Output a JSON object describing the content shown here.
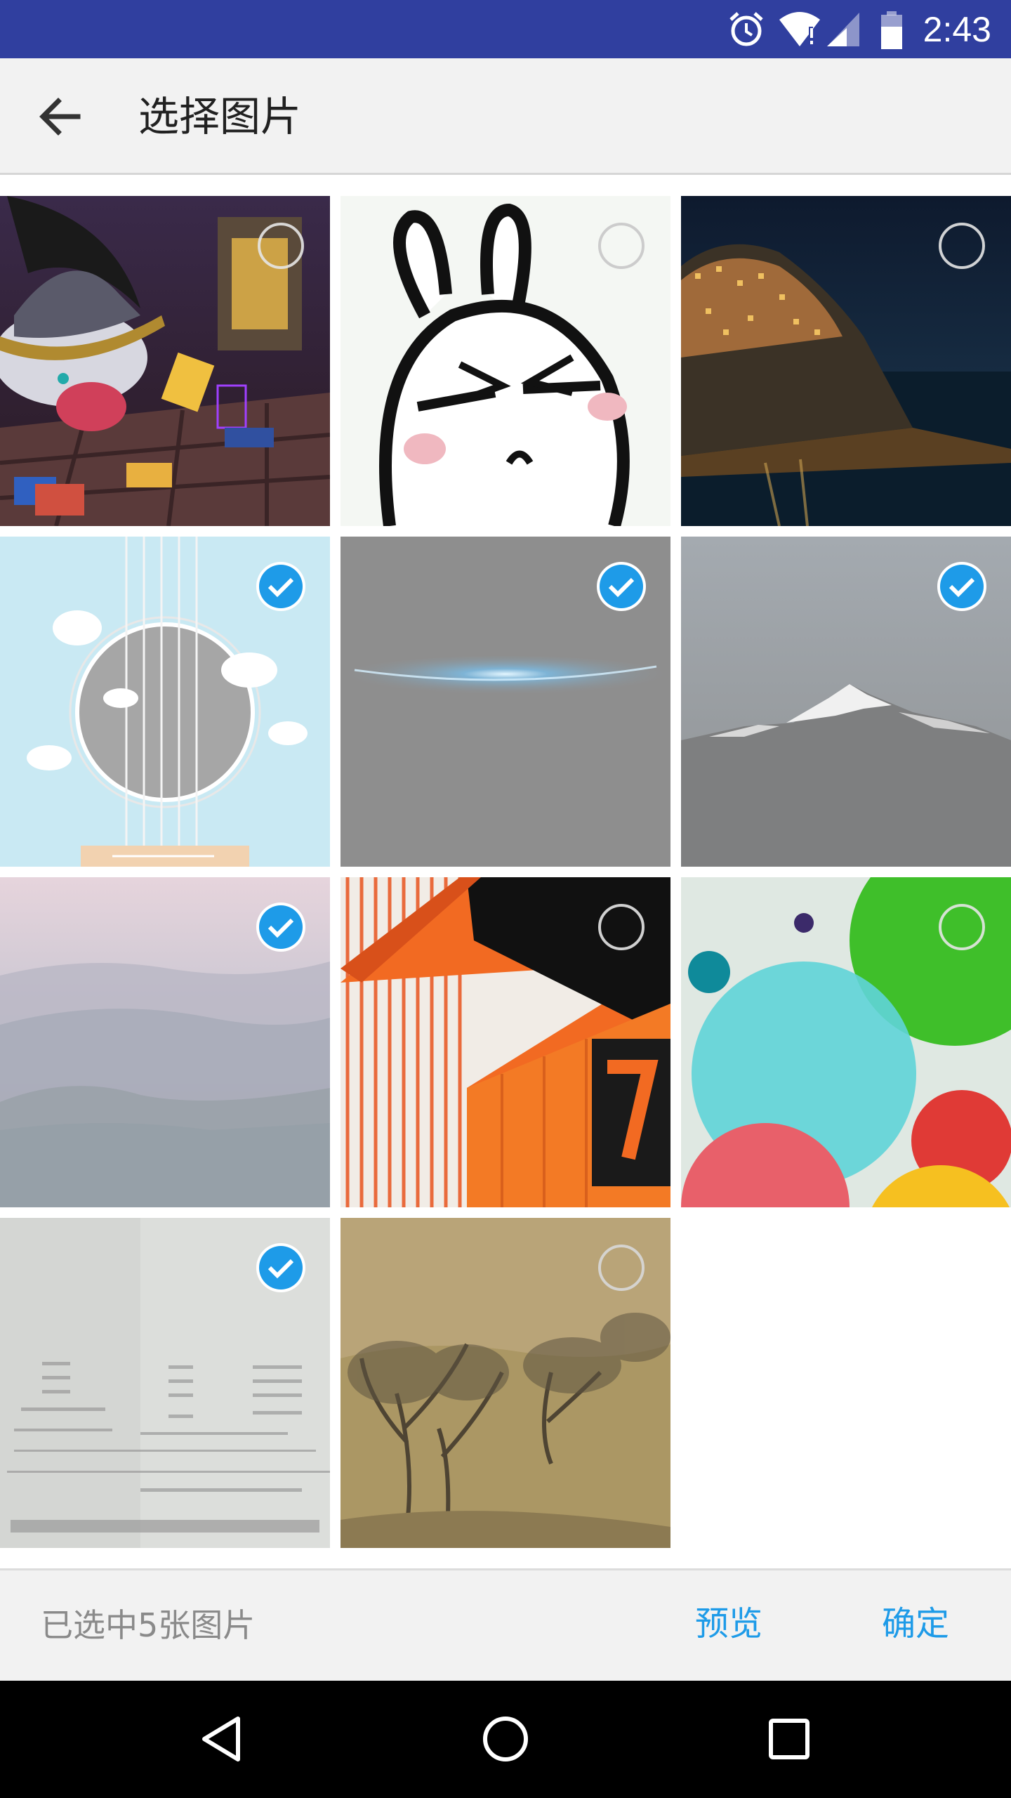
{
  "status_bar": {
    "time": "2:43",
    "icons": [
      "alarm-icon",
      "wifi-icon",
      "cellular-icon",
      "battery-icon"
    ],
    "color": "#303f9f"
  },
  "app_bar": {
    "title": "选择图片",
    "back_icon": "arrow-back-icon"
  },
  "grid": {
    "photos": [
      {
        "subject": "cartoon-character",
        "selected": false
      },
      {
        "subject": "rabbit-sticker",
        "selected": false
      },
      {
        "subject": "coastal-village-night",
        "selected": false
      },
      {
        "subject": "guitar-illustration",
        "selected": true
      },
      {
        "subject": "blue-light-streak",
        "selected": true
      },
      {
        "subject": "snow-mountain",
        "selected": true
      },
      {
        "subject": "misty-hills",
        "selected": true
      },
      {
        "subject": "orange-building-7",
        "selected": false
      },
      {
        "subject": "colorful-circles",
        "selected": false
      },
      {
        "subject": "paper-document",
        "selected": true
      },
      {
        "subject": "landscape-painting",
        "selected": false
      }
    ],
    "selected_color": "#1e9be8"
  },
  "bottom_bar": {
    "selection_count_text": "已选中5张图片",
    "preview_label": "预览",
    "confirm_label": "确定",
    "accent": "#1e9be8"
  },
  "nav_bar": {
    "icons": [
      "back-triangle-icon",
      "home-circle-icon",
      "recents-square-icon"
    ]
  }
}
